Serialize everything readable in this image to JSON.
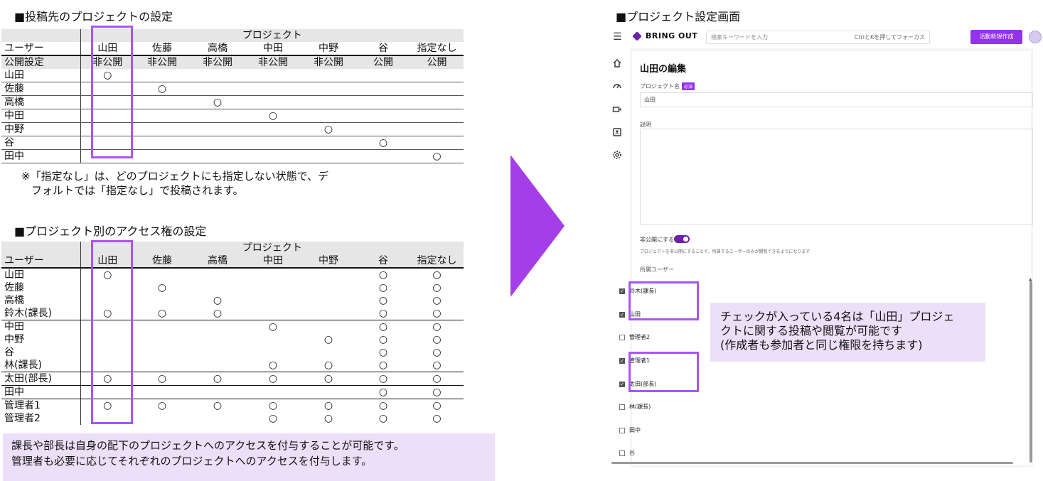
{
  "section1": {
    "title": "■投稿先のプロジェクトの設定",
    "header": {
      "project": "プロジェクト",
      "user": "ユーザー"
    },
    "columns": [
      "山田",
      "佐藤",
      "高橋",
      "中田",
      "中野",
      "谷",
      "指定なし"
    ],
    "public_row": {
      "label": "公開設定",
      "values": [
        "非公開",
        "非公開",
        "非公開",
        "非公開",
        "非公開",
        "公開",
        "公開"
      ]
    },
    "rows": [
      {
        "user": "山田",
        "marks": [
          "○",
          "",
          "",
          "",
          "",
          "",
          ""
        ]
      },
      {
        "user": "佐藤",
        "marks": [
          "",
          "○",
          "",
          "",
          "",
          "",
          ""
        ]
      },
      {
        "user": "高橋",
        "marks": [
          "",
          "",
          "○",
          "",
          "",
          "",
          ""
        ]
      },
      {
        "user": "中田",
        "marks": [
          "",
          "",
          "",
          "○",
          "",
          "",
          ""
        ]
      },
      {
        "user": "中野",
        "marks": [
          "",
          "",
          "",
          "",
          "○",
          "",
          ""
        ]
      },
      {
        "user": "谷",
        "marks": [
          "",
          "",
          "",
          "",
          "",
          "○",
          ""
        ]
      },
      {
        "user": "田中",
        "marks": [
          "",
          "",
          "",
          "",
          "",
          "",
          "○"
        ]
      }
    ],
    "note": [
      "※「指定なし」は、どのプロジェクトにも指定しない状態で、デ",
      "フォルトでは「指定なし」で投稿されます。"
    ]
  },
  "section2": {
    "title": "■プロジェクト別のアクセス権の設定",
    "header": {
      "project": "プロジェクト",
      "user": "ユーザー"
    },
    "columns": [
      "山田",
      "佐藤",
      "高橋",
      "中田",
      "中野",
      "谷",
      "指定なし"
    ],
    "rows": [
      {
        "user": "山田",
        "marks": [
          "○",
          "",
          "",
          "",
          "",
          "○",
          "○"
        ]
      },
      {
        "user": "佐藤",
        "marks": [
          "",
          "○",
          "",
          "",
          "",
          "○",
          "○"
        ]
      },
      {
        "user": "高橋",
        "marks": [
          "",
          "",
          "○",
          "",
          "",
          "○",
          "○"
        ]
      },
      {
        "user": "鈴木(課長)",
        "marks": [
          "○",
          "○",
          "○",
          "",
          "",
          "○",
          "○"
        ]
      },
      {
        "user": "中田",
        "marks": [
          "",
          "",
          "",
          "○",
          "",
          "○",
          "○"
        ]
      },
      {
        "user": "中野",
        "marks": [
          "",
          "",
          "",
          "",
          "○",
          "○",
          "○"
        ]
      },
      {
        "user": "谷",
        "marks": [
          "",
          "",
          "",
          "",
          "",
          "○",
          "○"
        ]
      },
      {
        "user": "林(課長)",
        "marks": [
          "",
          "",
          "",
          "○",
          "○",
          "○",
          "○"
        ]
      },
      {
        "user": "太田(部長)",
        "marks": [
          "○",
          "○",
          "○",
          "○",
          "○",
          "○",
          "○"
        ]
      },
      {
        "user": "田中",
        "marks": [
          "",
          "",
          "",
          "",
          "",
          "○",
          "○"
        ]
      },
      {
        "user": "管理者1",
        "marks": [
          "○",
          "○",
          "○",
          "○",
          "○",
          "○",
          "○"
        ]
      },
      {
        "user": "管理者2",
        "marks": [
          "",
          "",
          "",
          "○",
          "○",
          "○",
          "○"
        ]
      }
    ],
    "callout": [
      "課長や部長は自身の配下のプロジェクトへのアクセスを付与することが可能です。",
      "管理者も必要に応じてそれぞれのプロジェクトへのアクセスを付与します。"
    ]
  },
  "app": {
    "screen_title": "■プロジェクト設定画面",
    "logo": "BRING OUT",
    "search_placeholder": "検索キーワードを入力",
    "search_shortcut": "CtrlとKを押してフォーカス",
    "new_button": "活動新規作成",
    "page_title": "山田の編集",
    "project_name_label": "プロジェクト名",
    "required_badge": "必須",
    "project_name_value": "山田",
    "description_label": "説明",
    "private_label": "非公開にする",
    "private_enabled": true,
    "private_hint": "プロジェクトを非公開にすることで、所属するユーザーのみが閲覧できるようになります",
    "members_label": "所属ユーザー",
    "members": [
      {
        "name": "鈴木(課長)",
        "checked": true
      },
      {
        "name": "山田",
        "checked": true
      },
      {
        "name": "管理者2",
        "checked": false
      },
      {
        "name": "管理者1",
        "checked": true
      },
      {
        "name": "太田(部長)",
        "checked": true
      },
      {
        "name": "林(課長)",
        "checked": false
      },
      {
        "name": "田中",
        "checked": false
      },
      {
        "name": "谷",
        "checked": false
      }
    ],
    "callout": [
      "チェックが入っている4名は「山田」プロジェ",
      "クトに関する投稿や閲覧が可能です",
      "(作成者も参加者と同じ権限を持ちます)"
    ],
    "accent_color": "#9333ea",
    "highlight_color": "#a855f7",
    "arrow_color": "#a33ee8",
    "callout_bg": "#ecdff8"
  }
}
